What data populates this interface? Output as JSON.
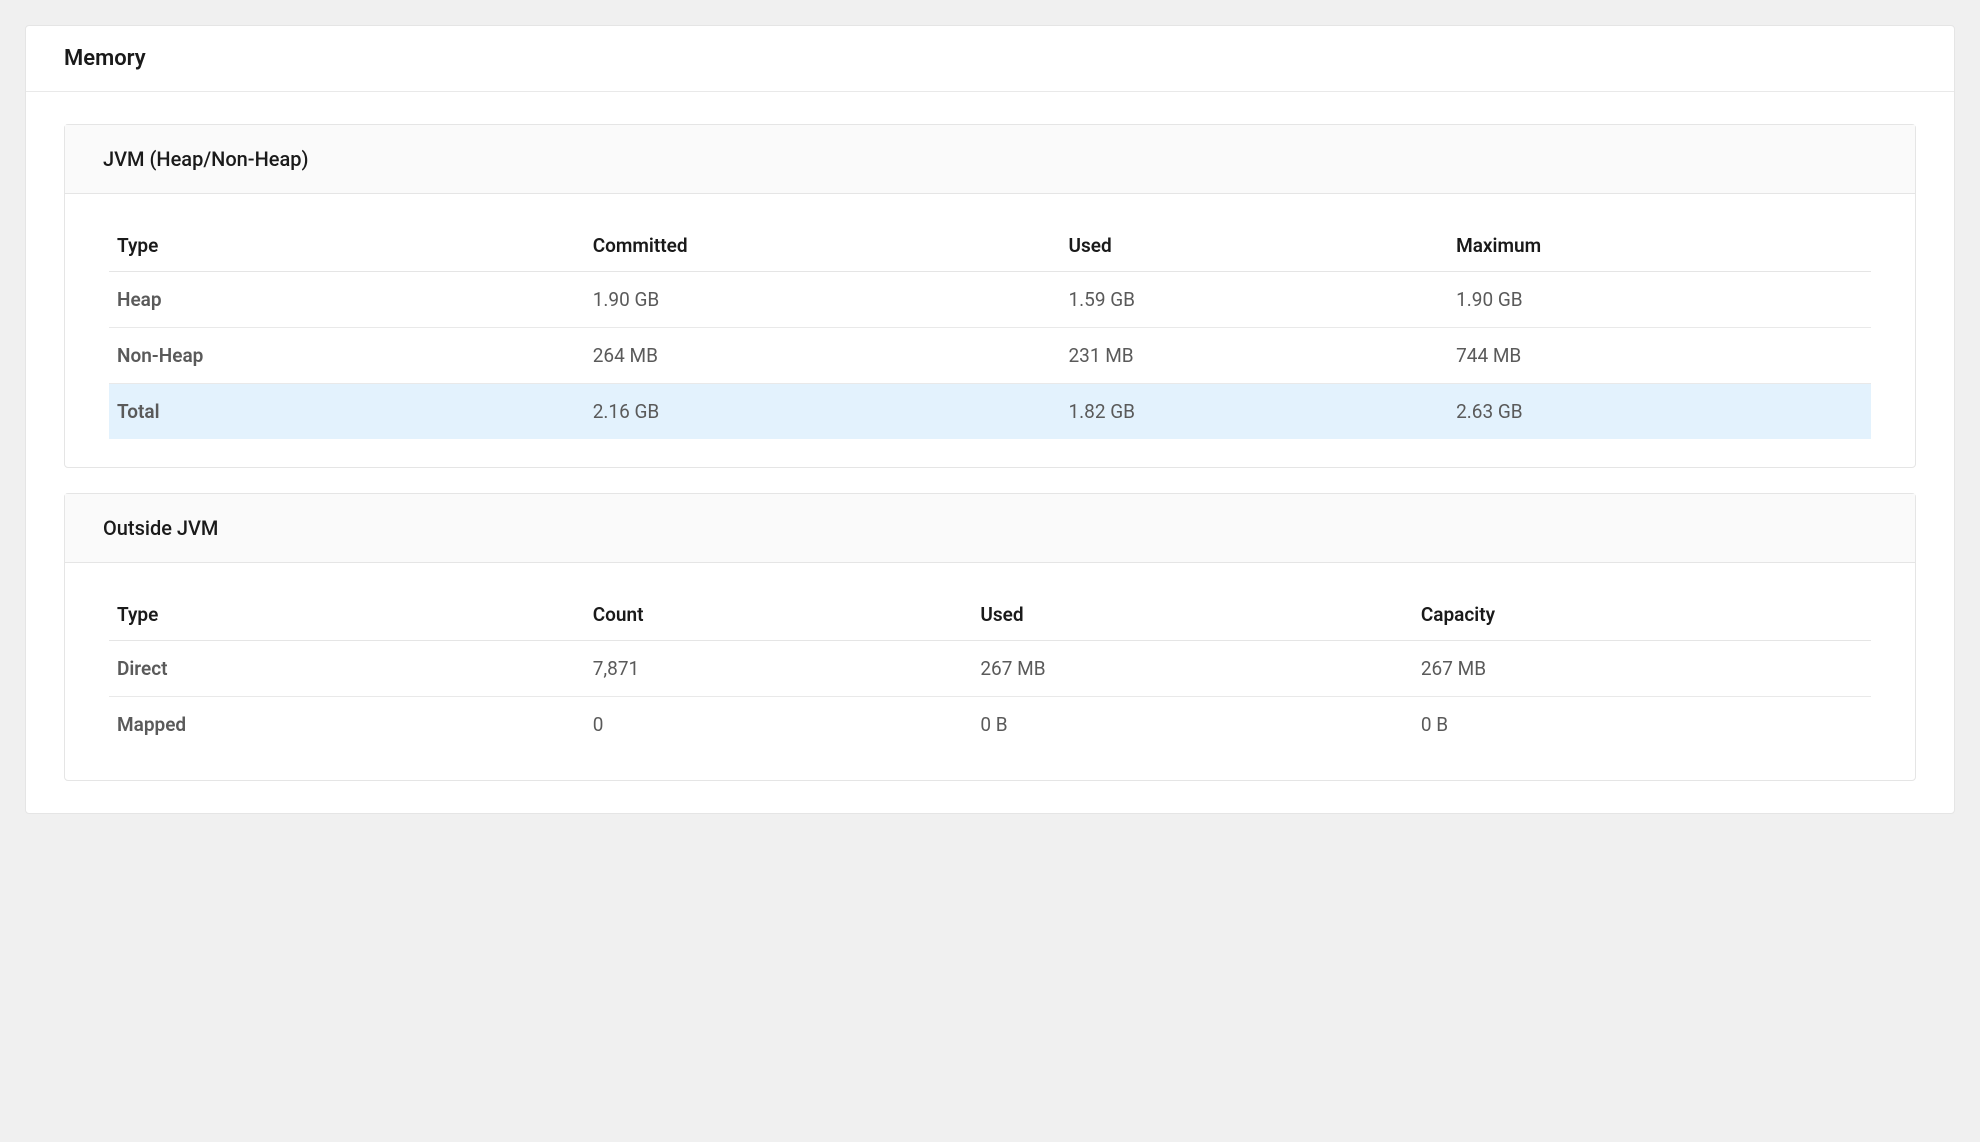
{
  "page": {
    "title": "Memory"
  },
  "jvm": {
    "title": "JVM (Heap/Non-Heap)",
    "headers": {
      "type": "Type",
      "committed": "Committed",
      "used": "Used",
      "maximum": "Maximum"
    },
    "rows": {
      "heap": {
        "type": "Heap",
        "committed": "1.90 GB",
        "used": "1.59 GB",
        "maximum": "1.90 GB"
      },
      "nonheap": {
        "type": "Non-Heap",
        "committed": "264 MB",
        "used": "231 MB",
        "maximum": "744 MB"
      },
      "total": {
        "type": "Total",
        "committed": "2.16 GB",
        "used": "1.82 GB",
        "maximum": "2.63 GB"
      }
    }
  },
  "outside": {
    "title": "Outside JVM",
    "headers": {
      "type": "Type",
      "count": "Count",
      "used": "Used",
      "capacity": "Capacity"
    },
    "rows": {
      "direct": {
        "type": "Direct",
        "count": "7,871",
        "used": "267 MB",
        "capacity": "267 MB"
      },
      "mapped": {
        "type": "Mapped",
        "count": "0",
        "used": "0 B",
        "capacity": "0 B"
      }
    }
  }
}
